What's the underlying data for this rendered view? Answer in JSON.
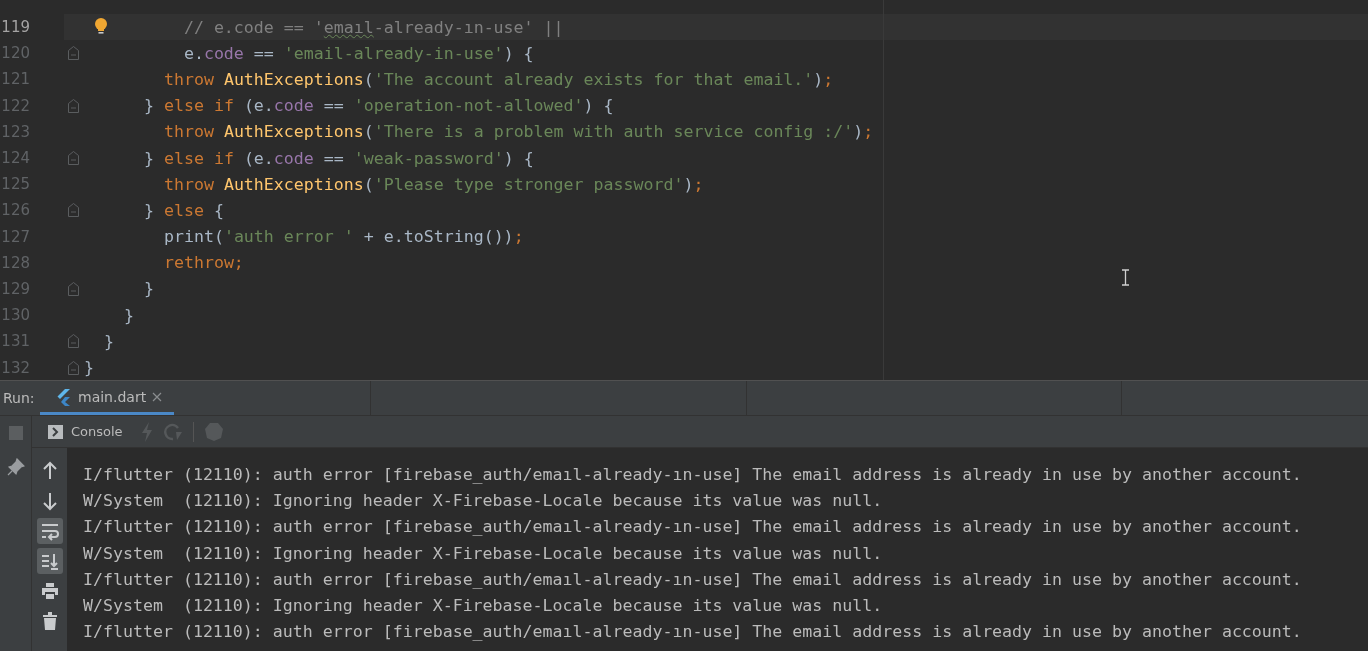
{
  "editor": {
    "lines": [
      {
        "number": "119",
        "current": true,
        "bulb": true,
        "fold": false,
        "tokens": [
          {
            "kind": "cmt",
            "text": "          // e.code == '"
          },
          {
            "kind": "typo",
            "text": "emaıl"
          },
          {
            "kind": "cmt",
            "text": "-already-ın-use' ||"
          }
        ]
      },
      {
        "number": "120",
        "current": false,
        "bulb": false,
        "fold": true,
        "tokens": [
          {
            "kind": "txt",
            "text": "          e."
          },
          {
            "kind": "fld",
            "text": "code"
          },
          {
            "kind": "txt",
            "text": " == "
          },
          {
            "kind": "str",
            "text": "'email-already-in-use'"
          },
          {
            "kind": "txt",
            "text": ") {"
          }
        ]
      },
      {
        "number": "121",
        "current": false,
        "bulb": false,
        "fold": false,
        "tokens": [
          {
            "kind": "kw",
            "text": "        throw "
          },
          {
            "kind": "cls",
            "text": "AuthExceptions"
          },
          {
            "kind": "txt",
            "text": "("
          },
          {
            "kind": "str",
            "text": "'The account already exists for that email.'"
          },
          {
            "kind": "txt",
            "text": ")"
          },
          {
            "kind": "kw",
            "text": ";"
          }
        ]
      },
      {
        "number": "122",
        "current": false,
        "bulb": false,
        "fold": true,
        "tokens": [
          {
            "kind": "txt",
            "text": "      } "
          },
          {
            "kind": "kw",
            "text": "else if "
          },
          {
            "kind": "txt",
            "text": "(e."
          },
          {
            "kind": "fld",
            "text": "code"
          },
          {
            "kind": "txt",
            "text": " == "
          },
          {
            "kind": "str",
            "text": "'operation-not-allowed'"
          },
          {
            "kind": "txt",
            "text": ") {"
          }
        ]
      },
      {
        "number": "123",
        "current": false,
        "bulb": false,
        "fold": false,
        "tokens": [
          {
            "kind": "kw",
            "text": "        throw "
          },
          {
            "kind": "cls",
            "text": "AuthExceptions"
          },
          {
            "kind": "txt",
            "text": "("
          },
          {
            "kind": "str",
            "text": "'There is a problem with auth service config :/'"
          },
          {
            "kind": "txt",
            "text": ")"
          },
          {
            "kind": "kw",
            "text": ";"
          }
        ]
      },
      {
        "number": "124",
        "current": false,
        "bulb": false,
        "fold": true,
        "tokens": [
          {
            "kind": "txt",
            "text": "      } "
          },
          {
            "kind": "kw",
            "text": "else if "
          },
          {
            "kind": "txt",
            "text": "(e."
          },
          {
            "kind": "fld",
            "text": "code"
          },
          {
            "kind": "txt",
            "text": " == "
          },
          {
            "kind": "str",
            "text": "'weak-password'"
          },
          {
            "kind": "txt",
            "text": ") {"
          }
        ]
      },
      {
        "number": "125",
        "current": false,
        "bulb": false,
        "fold": false,
        "tokens": [
          {
            "kind": "kw",
            "text": "        throw "
          },
          {
            "kind": "cls",
            "text": "AuthExceptions"
          },
          {
            "kind": "txt",
            "text": "("
          },
          {
            "kind": "str",
            "text": "'Please type stronger password'"
          },
          {
            "kind": "txt",
            "text": ")"
          },
          {
            "kind": "kw",
            "text": ";"
          }
        ]
      },
      {
        "number": "126",
        "current": false,
        "bulb": false,
        "fold": true,
        "tokens": [
          {
            "kind": "txt",
            "text": "      } "
          },
          {
            "kind": "kw",
            "text": "else "
          },
          {
            "kind": "txt",
            "text": "{"
          }
        ]
      },
      {
        "number": "127",
        "current": false,
        "bulb": false,
        "fold": false,
        "tokens": [
          {
            "kind": "txt",
            "text": "        print("
          },
          {
            "kind": "str",
            "text": "'auth error '"
          },
          {
            "kind": "txt",
            "text": " + e.toString())"
          },
          {
            "kind": "kw",
            "text": ";"
          }
        ]
      },
      {
        "number": "128",
        "current": false,
        "bulb": false,
        "fold": false,
        "tokens": [
          {
            "kind": "kw",
            "text": "        rethrow;"
          }
        ]
      },
      {
        "number": "129",
        "current": false,
        "bulb": false,
        "fold": true,
        "tokens": [
          {
            "kind": "txt",
            "text": "      }"
          }
        ]
      },
      {
        "number": "130",
        "current": false,
        "bulb": false,
        "fold": false,
        "tokens": [
          {
            "kind": "txt",
            "text": "    }"
          }
        ]
      },
      {
        "number": "131",
        "current": false,
        "bulb": false,
        "fold": true,
        "tokens": [
          {
            "kind": "txt",
            "text": "  }"
          }
        ]
      },
      {
        "number": "132",
        "current": false,
        "bulb": false,
        "fold": true,
        "tokens": [
          {
            "kind": "txt",
            "text": "}"
          }
        ]
      }
    ]
  },
  "run_bar": {
    "label": "Run:",
    "tabs": [
      {
        "label": "main.dart",
        "selected": true
      }
    ]
  },
  "toolbar": {
    "tabs": [
      {
        "label": "Console",
        "selected": true
      }
    ]
  },
  "side_tools": [
    {
      "kind": "up",
      "selected": false
    },
    {
      "kind": "down",
      "selected": false
    },
    {
      "kind": "wrap",
      "selected": true
    },
    {
      "kind": "scroll-end",
      "selected": true
    },
    {
      "kind": "print",
      "selected": false
    },
    {
      "kind": "trash",
      "selected": false
    }
  ],
  "console": {
    "lines": [
      "I/flutter (12110): auth error [firebase_auth/emaıl-already-ın-use] The email address is already in use by another account.",
      "W/System  (12110): Ignoring header X-Firebase-Locale because its value was null.",
      "I/flutter (12110): auth error [firebase_auth/emaıl-already-ın-use] The email address is already in use by another account.",
      "W/System  (12110): Ignoring header X-Firebase-Locale because its value was null.",
      "I/flutter (12110): auth error [firebase_auth/emaıl-already-ın-use] The email address is already in use by another account.",
      "W/System  (12110): Ignoring header X-Firebase-Locale because its value was null.",
      "I/flutter (12110): auth error [firebase_auth/emaıl-already-ın-use] The email address is already in use by another account."
    ]
  }
}
